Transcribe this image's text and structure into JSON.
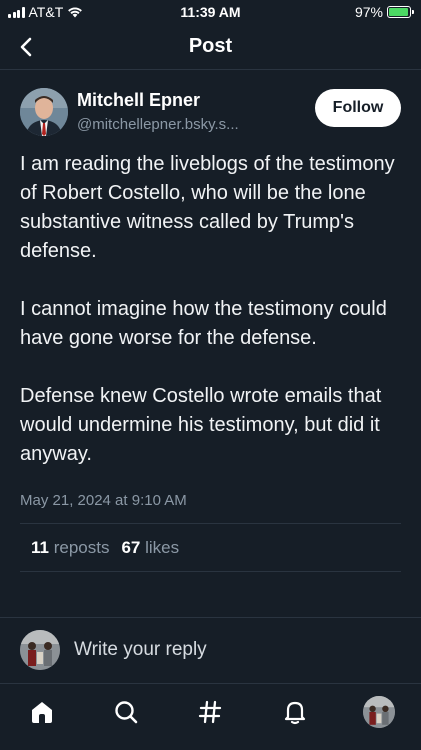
{
  "status_bar": {
    "carrier": "AT&T",
    "time": "11:39 AM",
    "battery": "97%",
    "battery_level": 0.97
  },
  "header": {
    "title": "Post",
    "back_icon": "chevron-left-icon"
  },
  "post": {
    "author_name": "Mitchell Epner",
    "author_handle": "@mitchellepner.bsky.s...",
    "follow_label": "Follow",
    "paragraphs": [
      "I am reading the liveblogs of the testimony of Robert Costello, who will be the lone substantive witness called by Trump's defense.",
      "I cannot imagine how the testimony could have gone worse for the defense.",
      "Defense knew Costello wrote emails that would undermine his testimony, but did it anyway."
    ],
    "timestamp": "May 21, 2024 at 9:10 AM",
    "reposts_count": "11",
    "reposts_label": "reposts",
    "likes_count": "67",
    "likes_label": "likes"
  },
  "reply": {
    "placeholder": "Write your reply"
  },
  "tabs": [
    {
      "name": "home",
      "icon": "home-icon"
    },
    {
      "name": "search",
      "icon": "search-icon"
    },
    {
      "name": "feeds",
      "icon": "hashtag-icon"
    },
    {
      "name": "notifications",
      "icon": "bell-icon"
    },
    {
      "name": "profile",
      "icon": "avatar"
    }
  ]
}
